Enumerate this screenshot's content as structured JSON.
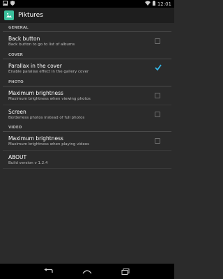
{
  "status_bar": {
    "time": "12:01"
  },
  "action_bar": {
    "title": "Piktures"
  },
  "sections": {
    "general": "GENERAL",
    "cover": "COVER",
    "photo": "PHOTO",
    "video": "VIDEO"
  },
  "prefs": {
    "back_button": {
      "title": "Back button",
      "summary": "Back button to go to list of albums",
      "checked": false
    },
    "parallax": {
      "title": "Parallax in the cover",
      "summary": "Enable parallax effect in the gallery cover",
      "checked": true
    },
    "photo_brightness": {
      "title": "Maximum brightness",
      "summary": "Maximum brightness when viewing photos",
      "checked": false
    },
    "screen": {
      "title": "Screen",
      "summary": "Borderless photos instead of full photos",
      "checked": false
    },
    "video_brightness": {
      "title": "Maximum brightness",
      "summary": "Maximum brightness when playing videos",
      "checked": false
    },
    "about": {
      "title": "ABOUT",
      "summary": "Build version v 1.2.4"
    }
  },
  "colors": {
    "accent": "#33b5e5",
    "app_icon": "#3bbf9c"
  },
  "icons": {
    "status_left": [
      "image-icon",
      "shield-icon"
    ],
    "status_right": [
      "wifi-icon",
      "battery-icon"
    ],
    "nav": [
      "back-icon",
      "home-icon",
      "recent-apps-icon"
    ]
  }
}
